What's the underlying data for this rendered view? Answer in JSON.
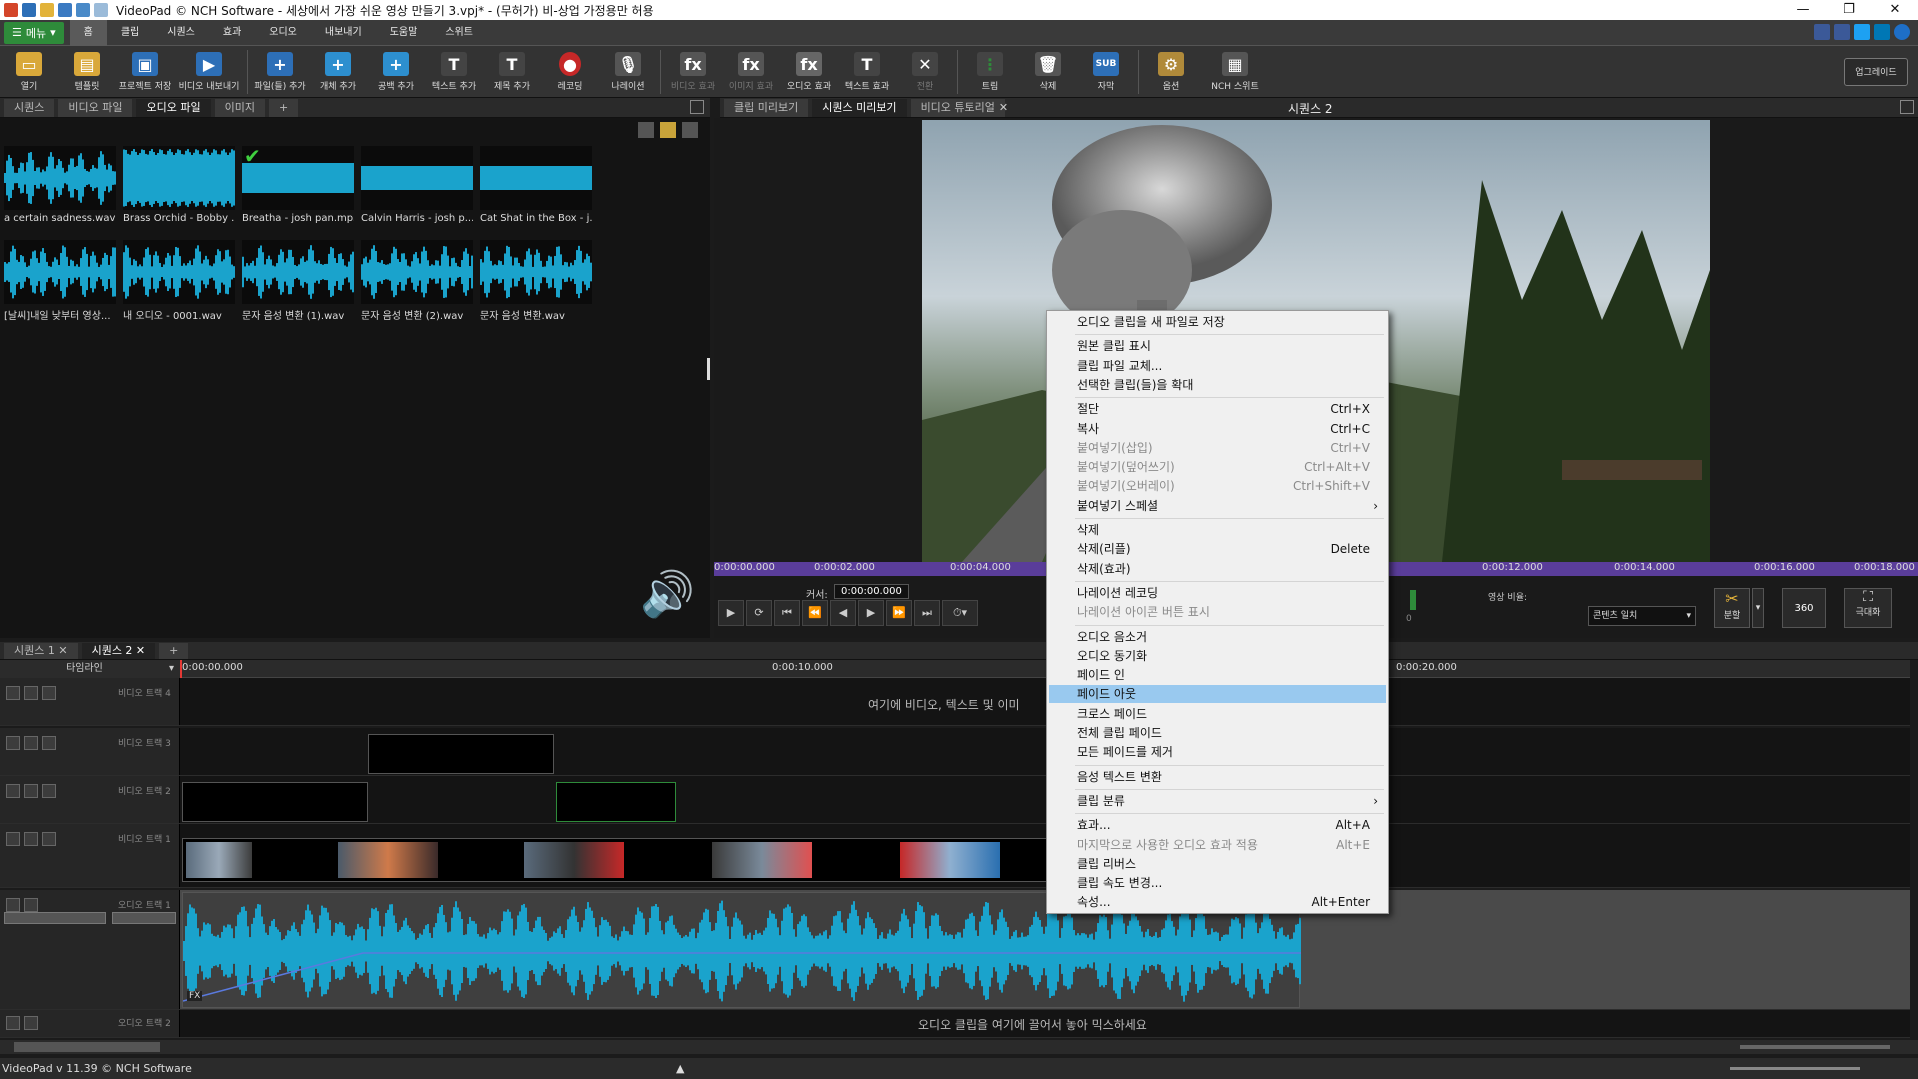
{
  "window": {
    "title": "VideoPad © NCH Software - 세상에서 가장 쉬운 영상 만들기 3.vpj* - (무허가) 비-상업 가정용만 허용",
    "minimize": "—",
    "restore": "❐",
    "close": "✕"
  },
  "menubar": {
    "menu_button": "메뉴",
    "tabs": [
      "홈",
      "클립",
      "시퀀스",
      "효과",
      "오디오",
      "내보내기",
      "도움말",
      "스위트"
    ]
  },
  "toolbar": {
    "buttons": [
      {
        "label": "열기",
        "icon": "folder-open-icon"
      },
      {
        "label": "템플릿",
        "icon": "template-icon"
      },
      {
        "label": "프로젝트 저장",
        "icon": "save-icon"
      },
      {
        "label": "비디오 내보내기",
        "icon": "export-video-icon"
      },
      {
        "label": "파일(들) 추가",
        "icon": "add-file-icon"
      },
      {
        "label": "개체 추가",
        "icon": "add-object-icon"
      },
      {
        "label": "공백 추가",
        "icon": "add-blank-icon"
      },
      {
        "label": "텍스트 추가",
        "icon": "add-text-icon"
      },
      {
        "label": "제목 추가",
        "icon": "add-title-icon"
      },
      {
        "label": "레코딩",
        "icon": "record-icon"
      },
      {
        "label": "나레이션",
        "icon": "narration-mic-icon"
      },
      {
        "label": "비디오 효과",
        "icon": "video-fx-icon"
      },
      {
        "label": "이미지 효과",
        "icon": "image-fx-icon"
      },
      {
        "label": "오디오 효과",
        "icon": "audio-fx-icon"
      },
      {
        "label": "텍스트 효과",
        "icon": "text-fx-icon"
      },
      {
        "label": "전환",
        "icon": "transition-icon"
      },
      {
        "label": "트림",
        "icon": "trim-icon"
      },
      {
        "label": "삭제",
        "icon": "trash-icon"
      },
      {
        "label": "자막",
        "icon": "subtitle-icon"
      },
      {
        "label": "옵션",
        "icon": "options-icon"
      },
      {
        "label": "NCH 스위트",
        "icon": "nch-suite-icon"
      }
    ],
    "upgrade": "업그레이드"
  },
  "bin": {
    "tabs": [
      "시퀀스",
      "비디오 파일",
      "오디오 파일",
      "이미지",
      "+"
    ],
    "active_tab": 2,
    "files": [
      "a certain sadness.wav",
      "Brass Orchid - Bobby ...",
      "Breatha - josh pan.mp3",
      "Calvin Harris - josh p...",
      "Cat Shat in the Box - j...",
      "[날씨]내일 낮부터 영상...",
      "내 오디오 - 0001.wav",
      "문자 음성 변환 (1).wav",
      "문자 음성 변환 (2).wav",
      "문자 음성 변환.wav"
    ]
  },
  "preview": {
    "tabs": [
      "클립 미리보기",
      "시퀀스 미리보기",
      "비디오 튜토리얼"
    ],
    "active_tab": 1,
    "sequence_label": "시퀀스 2",
    "ruler_times": [
      "0:00:00.000",
      "0:00:02.000",
      "0:00:04.000",
      "0:00:12.000",
      "0:00:14.000",
      "0:00:16.000",
      "0:00:18.000"
    ],
    "cursor_label": "커서:",
    "cursor_value": "0:00:00.000",
    "aspect_label": "영상 비율:",
    "aspect_value": "콘텐츠 일치",
    "split_label": "분할",
    "btn_360": "360",
    "maximize_label": "극대화",
    "level_value": "0"
  },
  "timeline": {
    "tabs": [
      "시퀀스 1",
      "시퀀스 2",
      "+"
    ],
    "header_label": "타임라인",
    "ruler_times": [
      "0:00:00.000",
      "0:00:10.000",
      "0:00:20.000"
    ],
    "tracks": [
      "비디오 트랙 4",
      "비디오 트랙 3",
      "비디오 트랙 2",
      "비디오 트랙 1",
      "오디오 트랙 1",
      "오디오 트랙 2"
    ],
    "video_drop_hint": "여기에 비디오, 텍스트 및 이미",
    "audio_drop_hint": "오디오 클립을 여기에 끌어서 놓아 믹스하세요",
    "fx_label": "FX"
  },
  "status": {
    "text": "VideoPad v 11.39 © NCH Software"
  },
  "context_menu": {
    "items": [
      {
        "label": "오디오 클립을 새 파일로 저장",
        "shortcut": "",
        "disabled": false
      },
      {
        "label": "원본 클립 표시",
        "shortcut": "",
        "disabled": false
      },
      {
        "label": "클립 파일 교체...",
        "shortcut": "",
        "disabled": false
      },
      {
        "label": "선택한 클립(들)을 확대",
        "shortcut": "",
        "disabled": false
      },
      {
        "label": "절단",
        "shortcut": "Ctrl+X",
        "disabled": false
      },
      {
        "label": "복사",
        "shortcut": "Ctrl+C",
        "disabled": false
      },
      {
        "label": "붙여넣기(삽입)",
        "shortcut": "Ctrl+V",
        "disabled": true
      },
      {
        "label": "붙여넣기(덮어쓰기)",
        "shortcut": "Ctrl+Alt+V",
        "disabled": true
      },
      {
        "label": "붙여넣기(오버레이)",
        "shortcut": "Ctrl+Shift+V",
        "disabled": true
      },
      {
        "label": "붙여넣기 스페셜",
        "shortcut": "",
        "disabled": false,
        "submenu": true
      },
      {
        "label": "삭제",
        "shortcut": "",
        "disabled": false
      },
      {
        "label": "삭제(리플)",
        "shortcut": "Delete",
        "disabled": false
      },
      {
        "label": "삭제(효과)",
        "shortcut": "",
        "disabled": false
      },
      {
        "label": "나레이션 레코딩",
        "shortcut": "",
        "disabled": false
      },
      {
        "label": "나레이션 아이콘 버튼 표시",
        "shortcut": "",
        "disabled": true
      },
      {
        "label": "오디오 음소거",
        "shortcut": "",
        "disabled": false
      },
      {
        "label": "오디오 동기화",
        "shortcut": "",
        "disabled": false
      },
      {
        "label": "페이드 인",
        "shortcut": "",
        "disabled": false
      },
      {
        "label": "페이드 아웃",
        "shortcut": "",
        "disabled": false,
        "highlighted": true
      },
      {
        "label": "크로스 페이드",
        "shortcut": "",
        "disabled": false
      },
      {
        "label": "전체 클립 페이드",
        "shortcut": "",
        "disabled": false
      },
      {
        "label": "모든 페이드를 제거",
        "shortcut": "",
        "disabled": false
      },
      {
        "label": "음성 텍스트 변환",
        "shortcut": "",
        "disabled": false
      },
      {
        "label": "클립 분류",
        "shortcut": "",
        "disabled": false,
        "submenu": true
      },
      {
        "label": "효과...",
        "shortcut": "Alt+A",
        "disabled": false
      },
      {
        "label": "마지막으로 사용한 오디오 효과 적용",
        "shortcut": "Alt+E",
        "disabled": true
      },
      {
        "label": "클립 리버스",
        "shortcut": "",
        "disabled": false
      },
      {
        "label": "클립 속도 변경...",
        "shortcut": "",
        "disabled": false
      },
      {
        "label": "속성...",
        "shortcut": "Alt+Enter",
        "disabled": false
      }
    ]
  },
  "colors": {
    "accent_green": "#2e8b3a",
    "waveform": "#1aa3cc",
    "ruler_purple": "#5a3d9a",
    "highlight": "#99c9ef"
  }
}
